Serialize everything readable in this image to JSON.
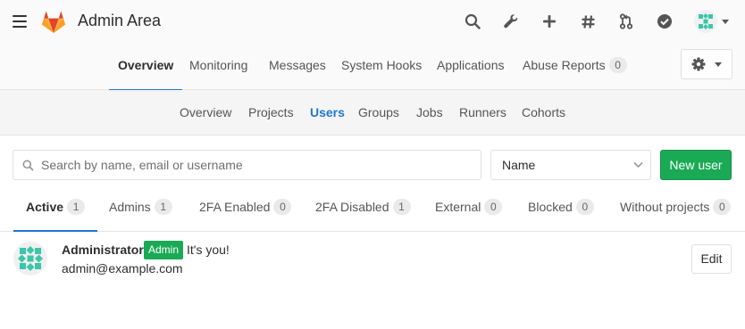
{
  "header": {
    "title": "Admin Area",
    "icons": [
      "search-icon",
      "wrench-icon",
      "plus-icon",
      "hash-icon",
      "merge-request-icon",
      "todo-check-icon"
    ]
  },
  "admin_nav": {
    "items": [
      {
        "label": "Overview",
        "active": true
      },
      {
        "label": "Monitoring"
      },
      {
        "label": "Messages"
      },
      {
        "label": "System Hooks"
      },
      {
        "label": "Applications"
      },
      {
        "label": "Abuse Reports",
        "count": "0"
      }
    ]
  },
  "section_nav": {
    "items": [
      {
        "label": "Overview"
      },
      {
        "label": "Projects"
      },
      {
        "label": "Users",
        "active": true
      },
      {
        "label": "Groups"
      },
      {
        "label": "Jobs"
      },
      {
        "label": "Runners"
      },
      {
        "label": "Cohorts"
      }
    ]
  },
  "search": {
    "placeholder": "Search by name, email or username",
    "value": ""
  },
  "sort": {
    "selected": "Name"
  },
  "new_user_label": "New user",
  "filter_tabs": [
    {
      "label": "Active",
      "count": "1",
      "active": true
    },
    {
      "label": "Admins",
      "count": "1"
    },
    {
      "label": "2FA Enabled",
      "count": "0"
    },
    {
      "label": "2FA Disabled",
      "count": "1"
    },
    {
      "label": "External",
      "count": "0"
    },
    {
      "label": "Blocked",
      "count": "0"
    },
    {
      "label": "Without projects",
      "count": "0"
    }
  ],
  "users": [
    {
      "name": "Administrator",
      "badge": "Admin",
      "note": "It's you!",
      "email": "admin@example.com",
      "edit_label": "Edit"
    }
  ],
  "colors": {
    "accent": "#1f78d1",
    "success": "#1aaa55",
    "logo": "#fc6d26"
  }
}
